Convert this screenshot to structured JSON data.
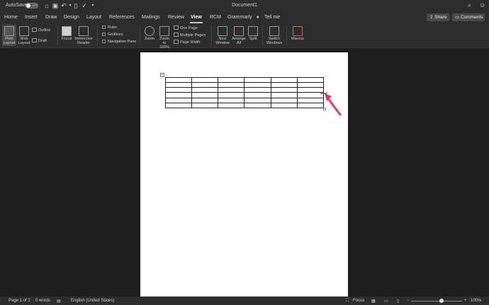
{
  "titlebar": {
    "autosave": "AutoSave",
    "toggle_state": "OFF",
    "doc_title": "Document1"
  },
  "tabs": [
    {
      "label": "Home"
    },
    {
      "label": "Insert"
    },
    {
      "label": "Draw"
    },
    {
      "label": "Design"
    },
    {
      "label": "Layout"
    },
    {
      "label": "References"
    },
    {
      "label": "Mailings"
    },
    {
      "label": "Review"
    },
    {
      "label": "View"
    },
    {
      "label": "RCM"
    },
    {
      "label": "Grammarly"
    },
    {
      "label": "Tell me"
    }
  ],
  "active_tab": "View",
  "share_label": "Share",
  "comments_label": "Comments",
  "ribbon": {
    "print_layout": [
      "Print",
      "Layout"
    ],
    "web_layout": [
      "Web",
      "Layout"
    ],
    "outline": "Outline",
    "draft": "Draft",
    "focus": "Focus",
    "immersive_reader": [
      "Immersive",
      "Reader"
    ],
    "ruler": "Ruler",
    "gridlines": "Gridlines",
    "navigation_pane": "Navigation Pane",
    "zoom": "Zoom",
    "zoom_100": [
      "Zoom",
      "to 100%"
    ],
    "one_page": "One Page",
    "multiple_pages": "Multiple Pages",
    "page_width": "Page Width",
    "new_window": [
      "New",
      "Window"
    ],
    "arrange_all": [
      "Arrange",
      "All"
    ],
    "split": "Split",
    "switch_windows": [
      "Switch",
      "Windows"
    ],
    "macros": "Macros"
  },
  "table": {
    "rows": 6,
    "cols": 6
  },
  "status": {
    "page": "Page 1 of 1",
    "words": "0 words",
    "language": "English (United States)",
    "focus": "Focus",
    "zoom": "100%",
    "zoom_minus": "−",
    "zoom_plus": "+"
  },
  "colors": {
    "arrow": "#e8336b",
    "bg": "#1e1e1e",
    "ribbon": "#2d2d2d"
  }
}
